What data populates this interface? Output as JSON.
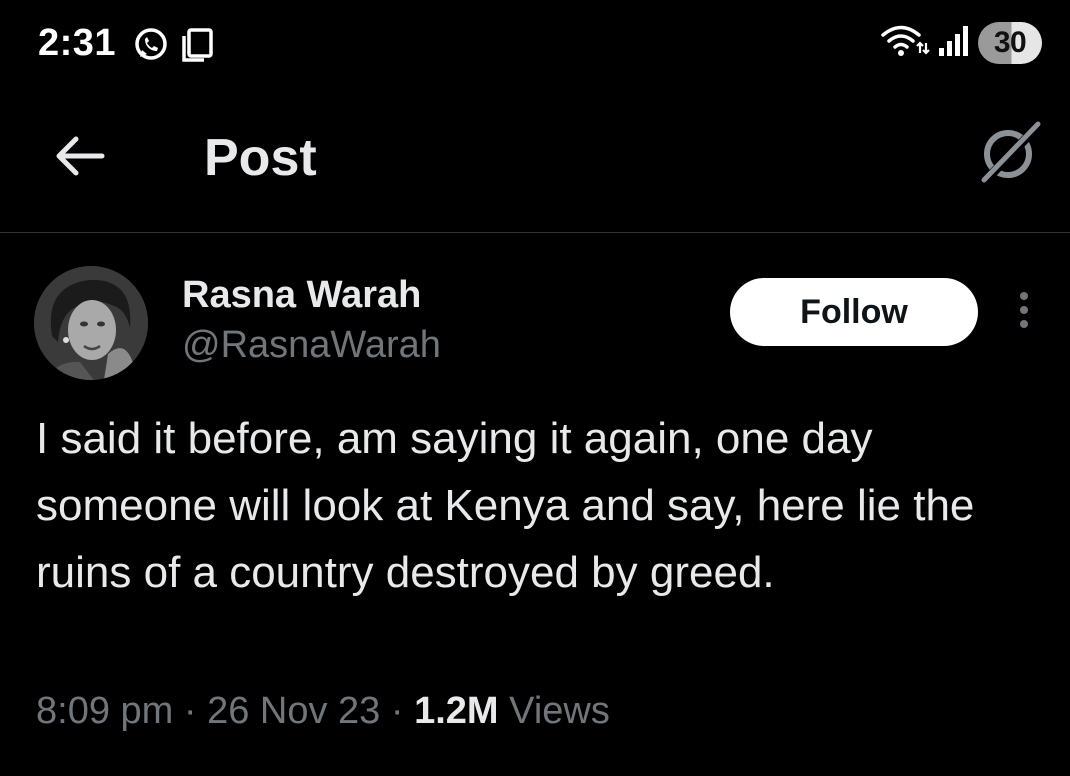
{
  "status_bar": {
    "time": "2:31",
    "left_icons": [
      "whatsapp-icon",
      "screenshot-icon"
    ],
    "right_icons": [
      "wifi-icon",
      "signal-icon"
    ],
    "battery_level": "30"
  },
  "header": {
    "title": "Post",
    "back_icon": "back-arrow-icon",
    "grok_icon": "grok-icon"
  },
  "post": {
    "author_name": "Rasna Warah",
    "author_handle": "@RasnaWarah",
    "follow_label": "Follow",
    "text": "I said it before, am saying it again, one day someone will look at Kenya and say, here lie the ruins of a country destroyed by greed.",
    "time": "8:09 pm",
    "separator": "·",
    "date": "26 Nov 23",
    "views_count": "1.2M",
    "views_label": "Views"
  },
  "colors": {
    "background": "#000000",
    "primary_text": "#e7e9ea",
    "secondary_text": "#71767b",
    "divider": "#2f3336",
    "follow_bg": "#ffffff"
  }
}
